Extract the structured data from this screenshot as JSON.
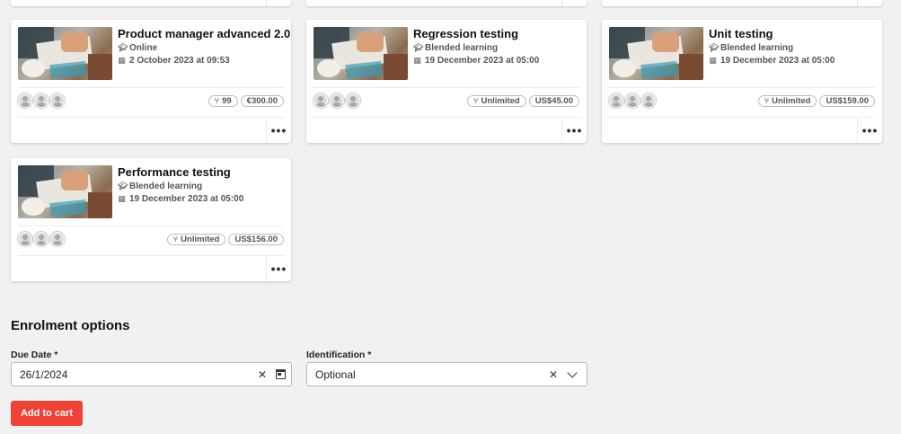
{
  "cards": [
    {
      "title": "Product manager advanced 2.0",
      "format": "Online",
      "date": "2 October 2023 at 09:53",
      "seats": "99",
      "price": "€300.00",
      "format_icon": "graduation-cap-icon",
      "date_icon": "calendar-icon"
    },
    {
      "title": "Regression testing",
      "format": "Blended learning",
      "date": "19 December 2023 at 05:00",
      "seats": "Unlimited",
      "price": "US$45.00",
      "format_icon": "graduation-cap-icon",
      "date_icon": "calendar-icon"
    },
    {
      "title": "Unit testing",
      "format": "Blended learning",
      "date": "19 December 2023 at 05:00",
      "seats": "Unlimited",
      "price": "US$159.00",
      "format_icon": "graduation-cap-icon",
      "date_icon": "calendar-icon"
    },
    {
      "title": "Performance testing",
      "format": "Blended learning",
      "date": "19 December 2023 at 05:00",
      "seats": "Unlimited",
      "price": "US$156.00",
      "format_icon": "graduation-cap-icon",
      "date_icon": "calendar-icon"
    }
  ],
  "more_label": "•••",
  "enrolment": {
    "title": "Enrolment options",
    "due_date_label": "Due Date *",
    "due_date_value": "26/1/2024",
    "identification_label": "Identification *",
    "identification_value": "Optional",
    "clear_glyph": "✕",
    "add_to_cart_label": "Add to cart"
  },
  "colors": {
    "accent": "#ef4136",
    "background": "#f1f1f1"
  }
}
